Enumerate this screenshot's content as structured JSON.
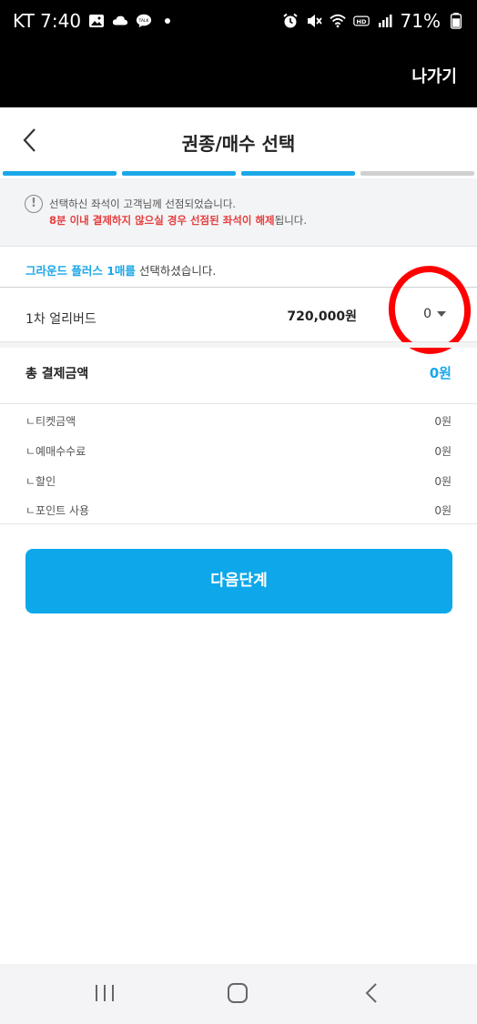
{
  "status_bar": {
    "carrier_time": "KT 7:40",
    "battery": "71%",
    "icons_left": [
      "gallery-icon",
      "cloud-icon",
      "talk-icon",
      "dot-icon"
    ],
    "icons_right": [
      "alarm-icon",
      "mute-icon",
      "wifi-icon",
      "hd-icon",
      "signal-icon",
      "battery-icon"
    ]
  },
  "header": {
    "exit_label": "나가기",
    "title": "권종/매수 선택"
  },
  "steps": {
    "colors": [
      "#1aa7e8",
      "#1aa7e8",
      "#1aa7e8",
      "#d0d0d0"
    ]
  },
  "notice": {
    "line1": "선택하신 좌석이 고객님께 선점되었습니다.",
    "line2_red_a": "8분 이내 결제하지 않으실 경우 선점된 좌석이 해제",
    "line2_rest": "됩니다."
  },
  "selection": {
    "highlight": "그라운드 플러스 1매를",
    "rest": " 선택하셨습니다."
  },
  "ticket": {
    "name": "1차 얼리버드",
    "price": "720,000원",
    "quantity": "0"
  },
  "total": {
    "label": "총 결제금액",
    "value": "0원"
  },
  "breakdown": [
    {
      "label": "ㄴ티켓금액",
      "value": "0원"
    },
    {
      "label": "ㄴ예매수수료",
      "value": "0원"
    },
    {
      "label": "ㄴ할인",
      "value": "0원"
    },
    {
      "label": "ㄴ포인트 사용",
      "value": "0원"
    }
  ],
  "next_button": "다음단계",
  "colors": {
    "accent": "#1aa7e8",
    "button": "#0ea8ea",
    "warning": "#e63f3f",
    "annotation": "#ff0000"
  }
}
